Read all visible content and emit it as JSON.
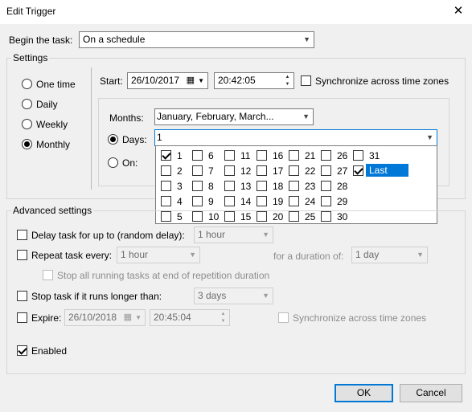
{
  "window": {
    "title": "Edit Trigger",
    "close_glyph": "✕"
  },
  "begin_task": {
    "label": "Begin the task:",
    "value": "On a schedule"
  },
  "settings": {
    "label": "Settings",
    "schedule_types": [
      {
        "label": "One time",
        "selected": false
      },
      {
        "label": "Daily",
        "selected": false
      },
      {
        "label": "Weekly",
        "selected": false
      },
      {
        "label": "Monthly",
        "selected": true
      }
    ],
    "start_label": "Start:",
    "start_date": "26/10/2017",
    "start_time": "20:42:05",
    "sync_label": "Synchronize across time zones",
    "months_label": "Months:",
    "months_value": "January, February, March...",
    "days_label": "Days:",
    "days_value": "1",
    "on_label": "On:"
  },
  "days_dropdown": {
    "columns": [
      [
        "1",
        "2",
        "3",
        "4",
        "5"
      ],
      [
        "6",
        "7",
        "8",
        "9",
        "10"
      ],
      [
        "11",
        "12",
        "13",
        "14",
        "15"
      ],
      [
        "16",
        "17",
        "18",
        "19",
        "20"
      ],
      [
        "21",
        "22",
        "23",
        "24",
        "25"
      ],
      [
        "26",
        "27",
        "28",
        "29",
        "30"
      ],
      [
        "31",
        "Last"
      ]
    ],
    "checked": [
      "1",
      "Last"
    ],
    "highlighted": "Last"
  },
  "advanced": {
    "label": "Advanced settings",
    "delay_label": "Delay task for up to (random delay):",
    "delay_value": "1 hour",
    "repeat_label": "Repeat task every:",
    "repeat_value": "1 hour",
    "duration_label": "for a duration of:",
    "duration_value": "1 day",
    "stop_running_label": "Stop all running tasks at end of repetition duration",
    "stop_if_label": "Stop task if it runs longer than:",
    "stop_if_value": "3 days",
    "expire_label": "Expire:",
    "expire_date": "26/10/2018",
    "expire_time": "20:45:04",
    "expire_sync_label": "Synchronize across time zones",
    "enabled_label": "Enabled"
  },
  "buttons": {
    "ok": "OK",
    "cancel": "Cancel"
  }
}
